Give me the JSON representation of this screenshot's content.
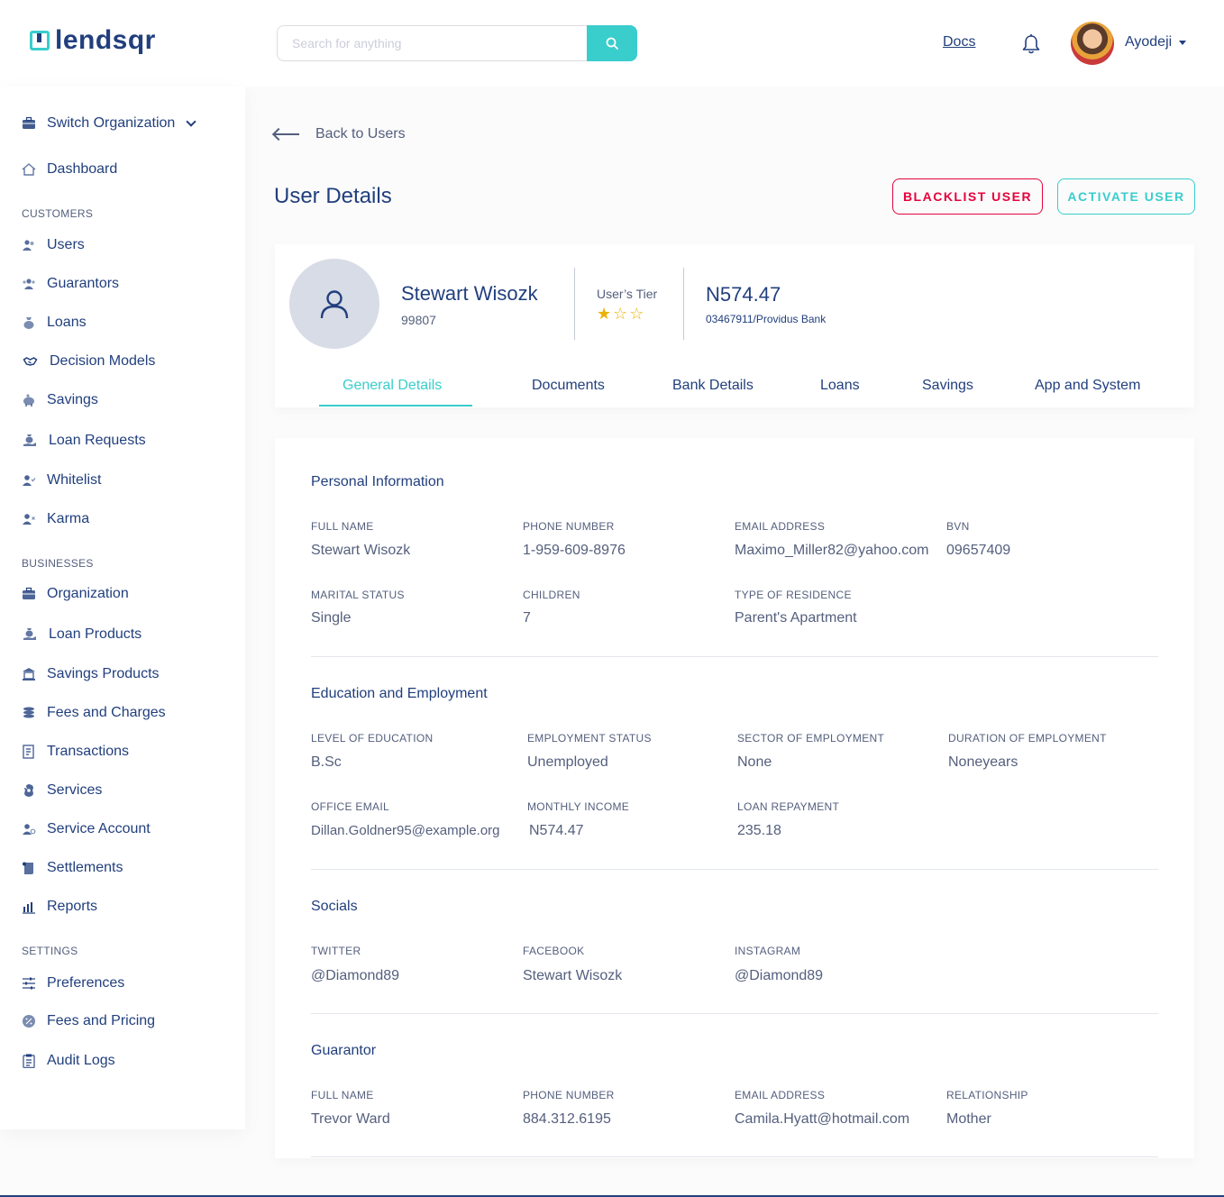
{
  "header": {
    "logo_text": "lendsqr",
    "search_placeholder": "Search for anything",
    "docs": "Docs",
    "user_name": "Ayodeji"
  },
  "sidebar": {
    "switch_org": "Switch Organization",
    "dashboard": "Dashboard",
    "sections": {
      "customers": "CUSTOMERS",
      "businesses": "BUSINESSES",
      "settings": "SETTINGS"
    },
    "customers": [
      "Users",
      "Guarantors",
      "Loans",
      "Decision Models",
      "Savings",
      "Loan Requests",
      "Whitelist",
      "Karma"
    ],
    "businesses": [
      "Organization",
      "Loan Products",
      "Savings Products",
      "Fees and Charges",
      "Transactions",
      "Services",
      "Service Account",
      "Settlements",
      "Reports"
    ],
    "settings": [
      "Preferences",
      "Fees and Pricing",
      "Audit Logs"
    ]
  },
  "page": {
    "back": "Back to Users",
    "title": "User Details",
    "blacklist": "BLACKLIST USER",
    "activate": "ACTIVATE USER"
  },
  "profile": {
    "name": "Stewart Wisozk",
    "id": "99807",
    "tier_label": "User’s Tier",
    "tier_stars": 1,
    "tier_max": 3,
    "balance": "N574.47",
    "bank": "03467911/Providus Bank",
    "tabs": [
      "General Details",
      "Documents",
      "Bank Details",
      "Loans",
      "Savings",
      "App and System"
    ],
    "active_tab": "General Details"
  },
  "personal": {
    "title": "Personal Information",
    "fields": [
      {
        "label": "FULL NAME",
        "value": "Stewart Wisozk"
      },
      {
        "label": "PHONE NUMBER",
        "value": "1-959-609-8976"
      },
      {
        "label": "EMAIL ADDRESS",
        "value": "Maximo_Miller82@yahoo.com"
      },
      {
        "label": "BVN",
        "value": "09657409"
      },
      {
        "label": "MARITAL STATUS",
        "value": "Single"
      },
      {
        "label": "CHILDREN",
        "value": "7"
      },
      {
        "label": "TYPE OF RESIDENCE",
        "value": "Parent's Apartment"
      }
    ]
  },
  "education": {
    "title": "Education and Employment",
    "fields": [
      {
        "label": "LEVEL OF EDUCATION",
        "value": "B.Sc"
      },
      {
        "label": "EMPLOYMENT STATUS",
        "value": "Unemployed"
      },
      {
        "label": "SECTOR OF EMPLOYMENT",
        "value": "None"
      },
      {
        "label": "DURATION OF EMPLOYMENT",
        "value": "Noneyears"
      },
      {
        "label": "OFFICE EMAIL",
        "value": "Dillan.Goldner95@example.org"
      },
      {
        "label": "MONTHLY INCOME",
        "value": "N574.47"
      },
      {
        "label": "LOAN REPAYMENT",
        "value": "235.18"
      }
    ]
  },
  "socials": {
    "title": "Socials",
    "fields": [
      {
        "label": "TWITTER",
        "value": "@Diamond89"
      },
      {
        "label": "FACEBOOK",
        "value": "Stewart Wisozk"
      },
      {
        "label": "INSTAGRAM",
        "value": "@Diamond89"
      }
    ]
  },
  "guarantor": {
    "title": "Guarantor",
    "fields": [
      {
        "label": "FULL NAME",
        "value": "Trevor Ward"
      },
      {
        "label": "PHONE NUMBER",
        "value": "884.312.6195"
      },
      {
        "label": "EMAIL ADDRESS",
        "value": "Camila.Hyatt@hotmail.com"
      },
      {
        "label": "RELATIONSHIP",
        "value": "Mother"
      }
    ]
  },
  "colors": {
    "primary": "#213f7d",
    "accent": "#39cdcc",
    "danger": "#e4033b",
    "star": "#e9b200"
  }
}
